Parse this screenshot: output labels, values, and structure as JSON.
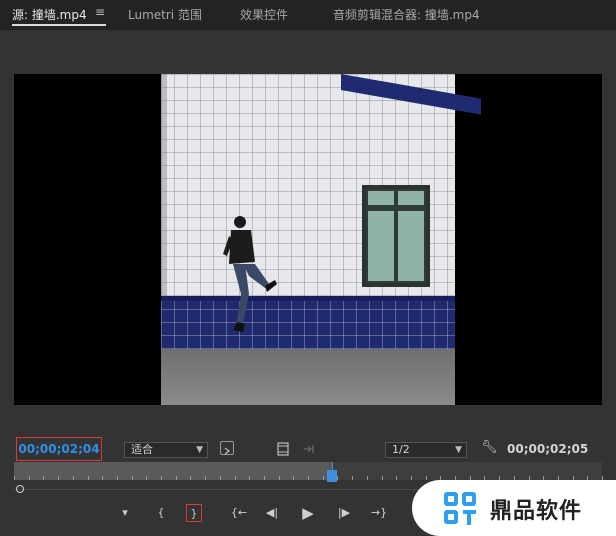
{
  "tabs": [
    {
      "label": "源: 撞墙.mp4",
      "active": true
    },
    {
      "label": "Lumetri 范围"
    },
    {
      "label": "效果控件"
    },
    {
      "label": "音频剪辑混合器: 撞墙.mp4"
    }
  ],
  "tab_menu_icon": "≡",
  "viewer": {
    "timecode_current": "00;00;02;04",
    "fit_label": "适合",
    "resolution_label": "1/2",
    "timecode_duration": "00;00;02;05"
  },
  "transport": {
    "buttons": [
      {
        "name": "add-marker-button",
        "icon": "marker-icon",
        "glyph": "▾"
      },
      {
        "name": "mark-in-button",
        "icon": "mark-in-icon",
        "glyph": "{"
      },
      {
        "name": "mark-out-button",
        "icon": "mark-out-icon",
        "glyph": "}"
      },
      {
        "name": "go-to-in-button",
        "icon": "go-to-in-icon",
        "glyph": "{←"
      },
      {
        "name": "step-back-button",
        "icon": "step-back-icon",
        "glyph": "◀|"
      },
      {
        "name": "play-button",
        "icon": "play-icon",
        "glyph": "▶"
      },
      {
        "name": "step-forward-button",
        "icon": "step-forward-icon",
        "glyph": "|▶"
      },
      {
        "name": "go-to-out-button",
        "icon": "go-to-out-icon",
        "glyph": "→}"
      }
    ]
  },
  "playback_progress": 0.54,
  "watermark": {
    "text": "鼎品软件"
  },
  "colors": {
    "timecode_blue": "#2f8fe6",
    "highlight_red": "#d73a3a",
    "playhead_blue": "#3d8fdf",
    "panel_bg": "#333333",
    "tab_bg": "#232323"
  }
}
